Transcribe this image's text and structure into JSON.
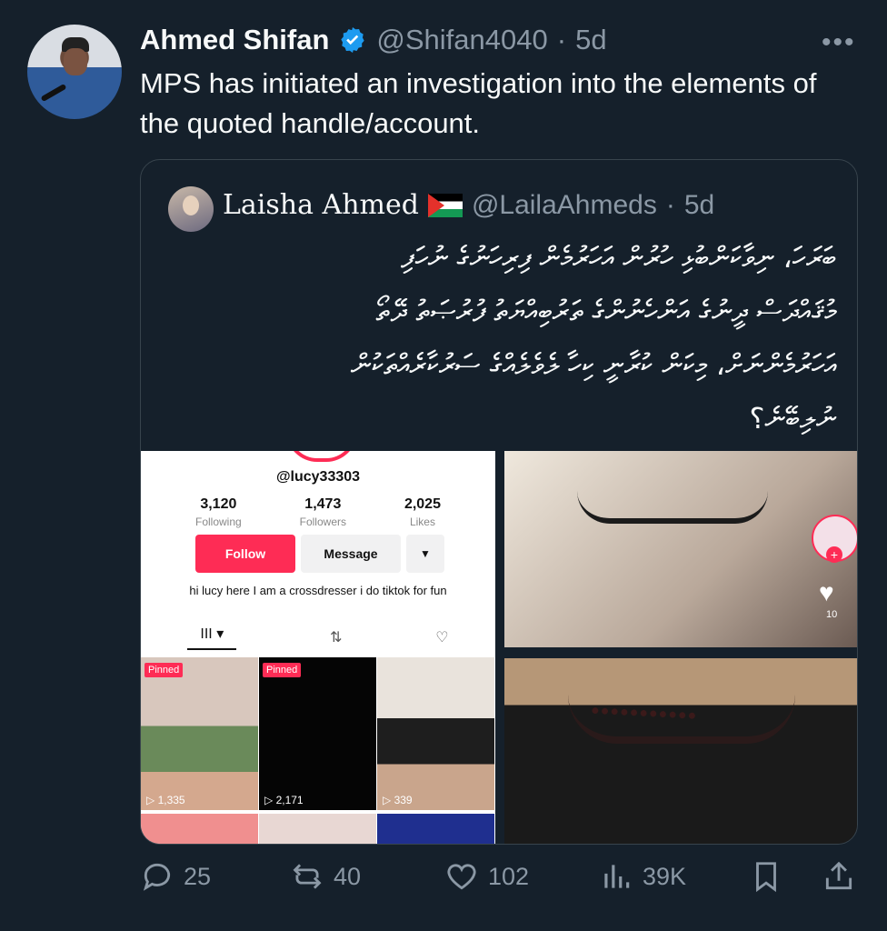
{
  "tweet": {
    "author_name": "Ahmed Shifan",
    "author_handle": "@Shifan4040",
    "separator": "·",
    "time": "5d",
    "more_label": "•••",
    "text": "MPS has initiated an investigation into the elements of the quoted handle/account."
  },
  "quoted": {
    "author_name": "Laisha Ahmed",
    "author_handle": "@LailaAhmeds",
    "separator": "·",
    "time": "5d",
    "text": "ބަރަހަ، ނިވާކަންބުޅި ހުރުން އަހަރުމެން ފިރިހަނުގެ ނުހަފި\nމުޤައްދަސް ދީނުގެ އަންހެނުންގެ ތަރުބިއްޔަތު ފުރުޞަތު ދޭތޯ\nއަހަރުމެންނަށް، މިކަން ކުރާނީ ކިހާ ލެވެލެއްގެ ސަރުކާރެއްތަކުން\nނުލިބޭނެ؟",
    "media": {
      "tiktok": {
        "username": "@lucy33303",
        "stats": [
          {
            "value": "3,120",
            "label": "Following"
          },
          {
            "value": "1,473",
            "label": "Followers"
          },
          {
            "value": "2,025",
            "label": "Likes"
          }
        ],
        "follow_label": "Follow",
        "message_label": "Message",
        "dropdown_label": "▼",
        "bio": "hi lucy here I am a crossdresser i do tiktok for fun",
        "tabs": [
          "III ▾",
          "⇅",
          "♡"
        ],
        "videos": [
          {
            "pinned": "Pinned",
            "views": "▷ 1,335"
          },
          {
            "pinned": "Pinned",
            "views": "▷ 2,171"
          },
          {
            "pinned": "",
            "views": "▷ 339"
          }
        ]
      },
      "side_like_count": "10"
    }
  },
  "actions": {
    "replies": "25",
    "reposts": "40",
    "likes": "102",
    "views": "39K"
  },
  "colors": {
    "background": "#15202b",
    "text": "#f7f9f9",
    "muted": "#8b98a5",
    "verified": "#1d9bf0",
    "tiktok_pink": "#fe2c55"
  }
}
